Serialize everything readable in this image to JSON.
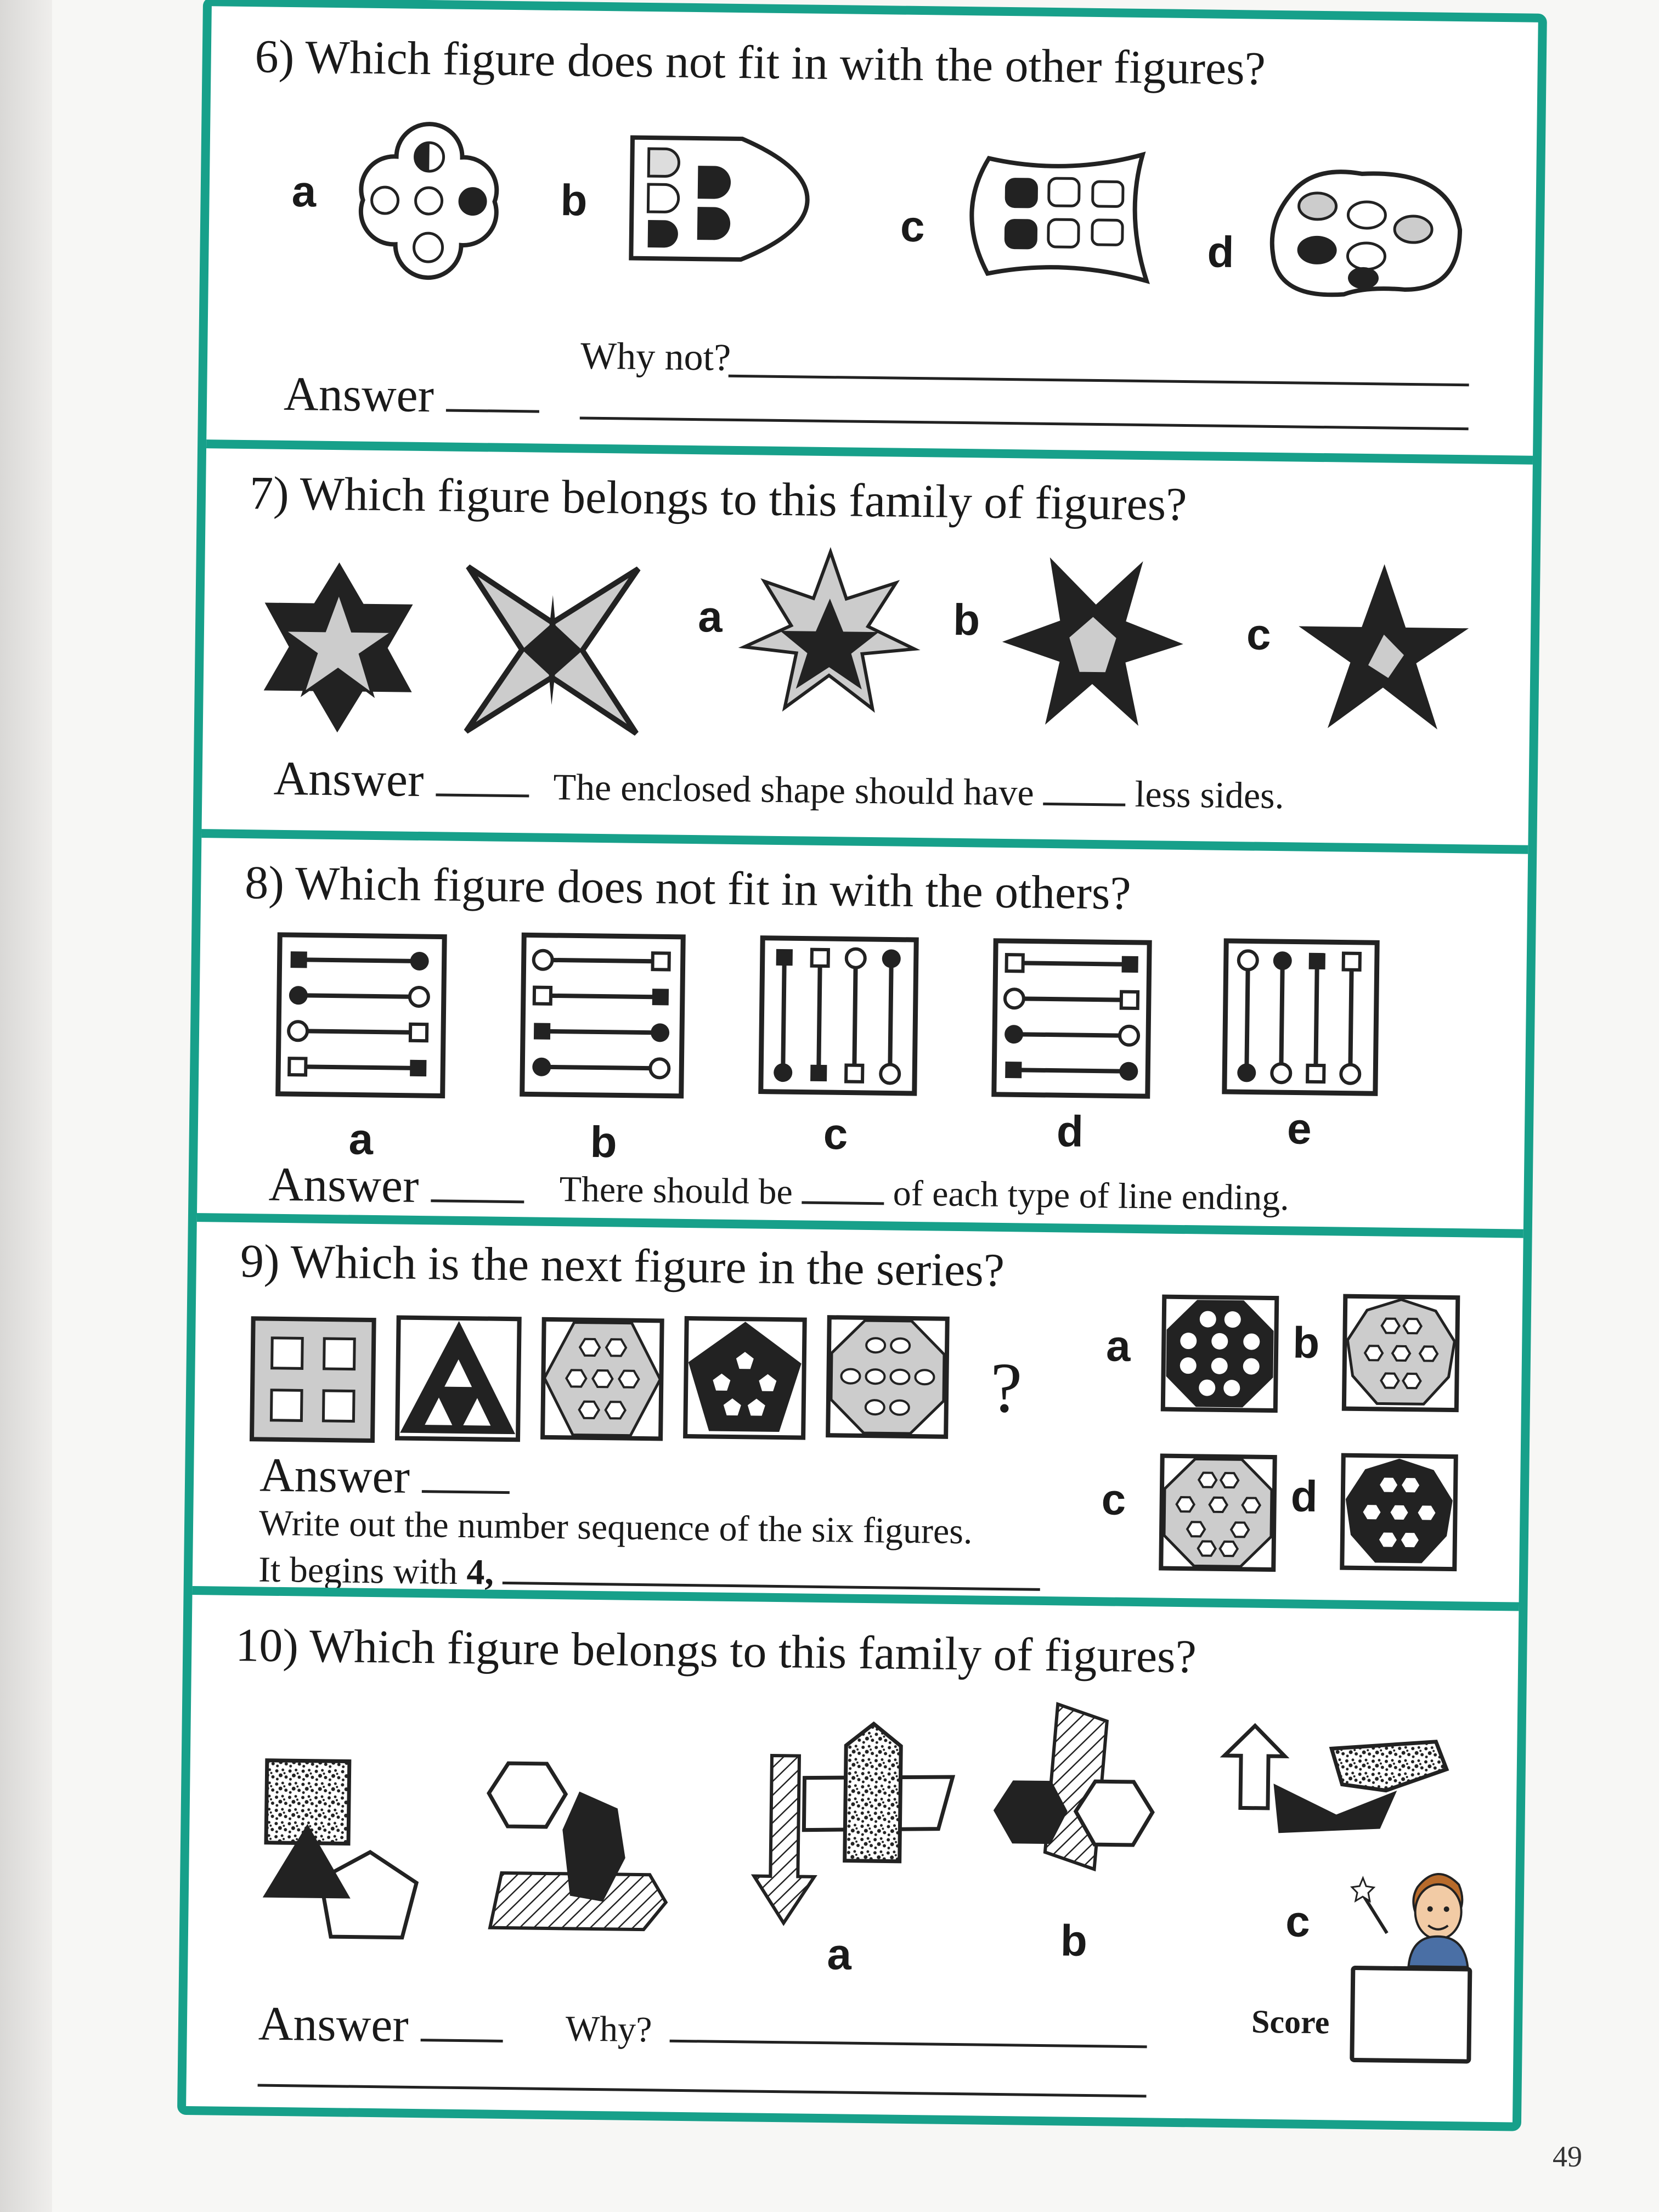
{
  "page_number": "49",
  "q6": {
    "title": "6) Which figure does not fit in with the other figures?",
    "labels": [
      "a",
      "b",
      "c",
      "d"
    ],
    "why": "Why not?",
    "answer": "Answer"
  },
  "q7": {
    "title": "7) Which figure belongs to this family of figures?",
    "labels": [
      "a",
      "b",
      "c"
    ],
    "answer": "Answer",
    "hint_pre": "The enclosed shape should have",
    "hint_post": "less sides."
  },
  "q8": {
    "title": "8) Which figure does not fit in with the others?",
    "labels": [
      "a",
      "b",
      "c",
      "d",
      "e"
    ],
    "answer": "Answer",
    "hint_pre": "There should be",
    "hint_post": "of each type of line ending."
  },
  "q9": {
    "title": "9) Which is the next figure in the series?",
    "question_mark": "?",
    "labels": [
      "a",
      "b",
      "c",
      "d"
    ],
    "answer": "Answer",
    "line1": "Write out the number sequence of the six figures.",
    "line2_pre": "It begins with",
    "line2_num": "4,"
  },
  "q10": {
    "title": "10) Which figure belongs to this family of figures?",
    "labels": [
      "a",
      "b",
      "c"
    ],
    "answer": "Answer",
    "why": "Why?",
    "score": "Score"
  }
}
